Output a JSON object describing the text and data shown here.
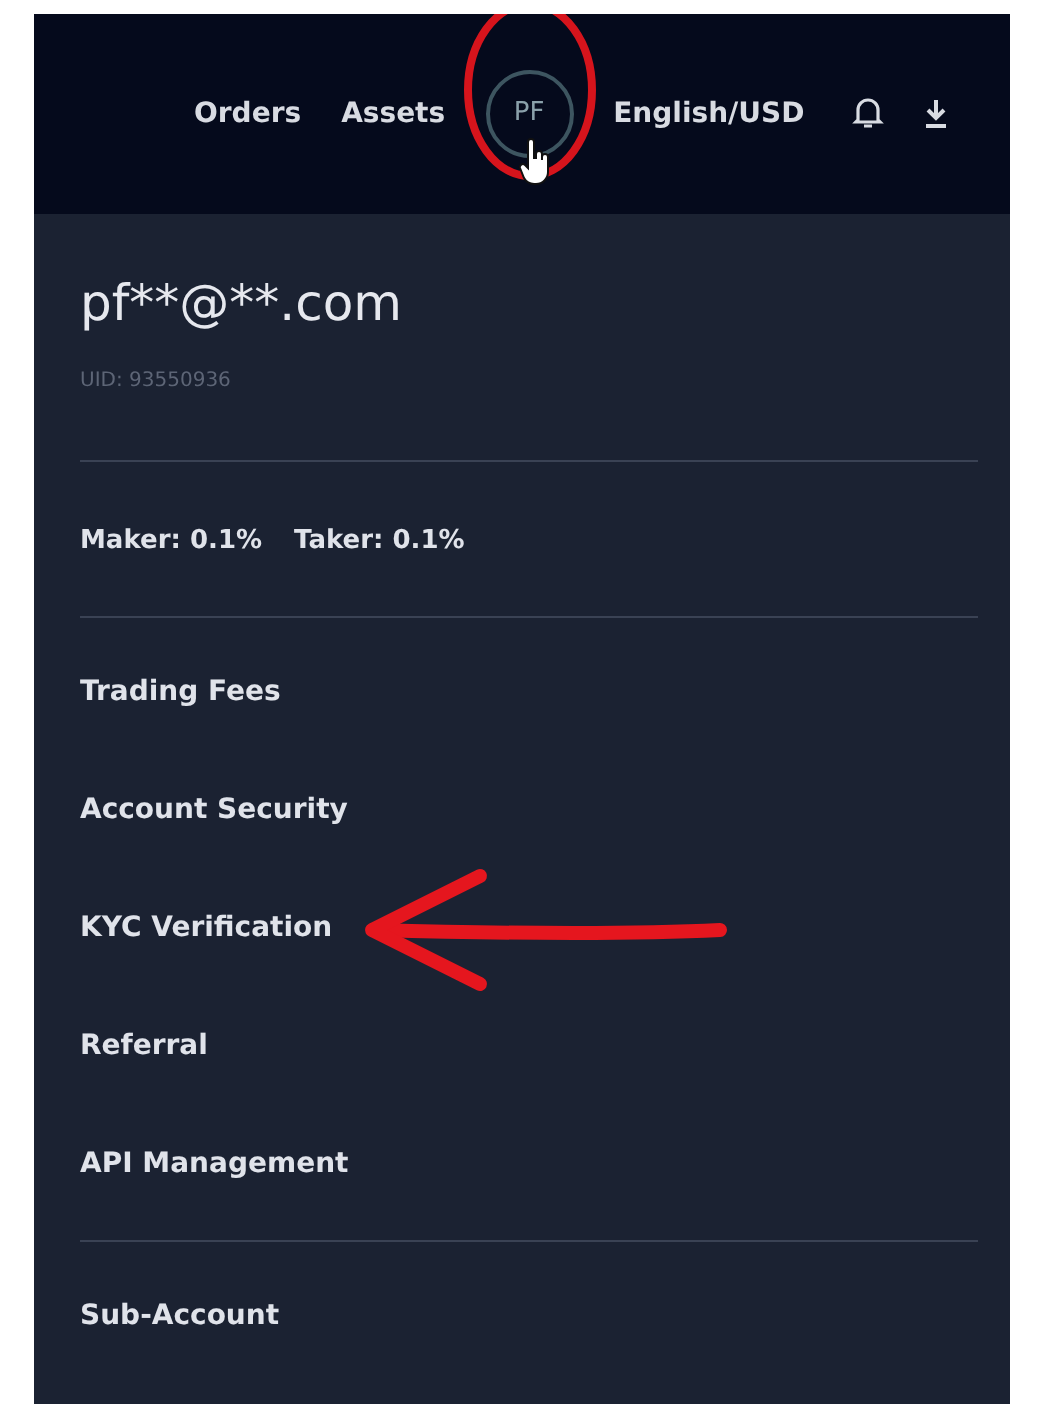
{
  "nav": {
    "links": [
      "Orders",
      "Assets"
    ],
    "avatar": "PF",
    "language": "English/USD"
  },
  "account": {
    "email": "pf**@**.com",
    "uid": "UID: 93550936",
    "fees": [
      "Maker: 0.1%",
      "Taker: 0.1%"
    ]
  },
  "menu_groups": [
    [
      "Trading Fees",
      "Account Security",
      "KYC Verification",
      "Referral",
      "API Management"
    ],
    [
      "Sub-Account"
    ]
  ]
}
